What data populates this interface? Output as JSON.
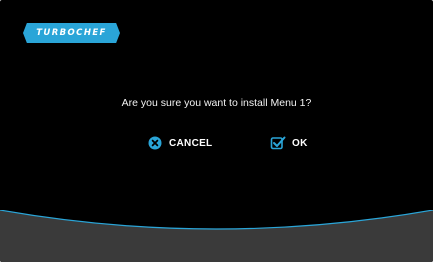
{
  "brand": {
    "logo_text": "TURBOCHEF"
  },
  "dialog": {
    "question": "Are you sure you want to install Menu 1?",
    "cancel_label": "CANCEL",
    "ok_label": "OK"
  },
  "icons": {
    "cancel": "close-circle-icon",
    "ok": "checkbox-check-icon"
  },
  "colors": {
    "background": "#000000",
    "accent": "#2aa5d8",
    "footer": "#3a3a3a"
  }
}
